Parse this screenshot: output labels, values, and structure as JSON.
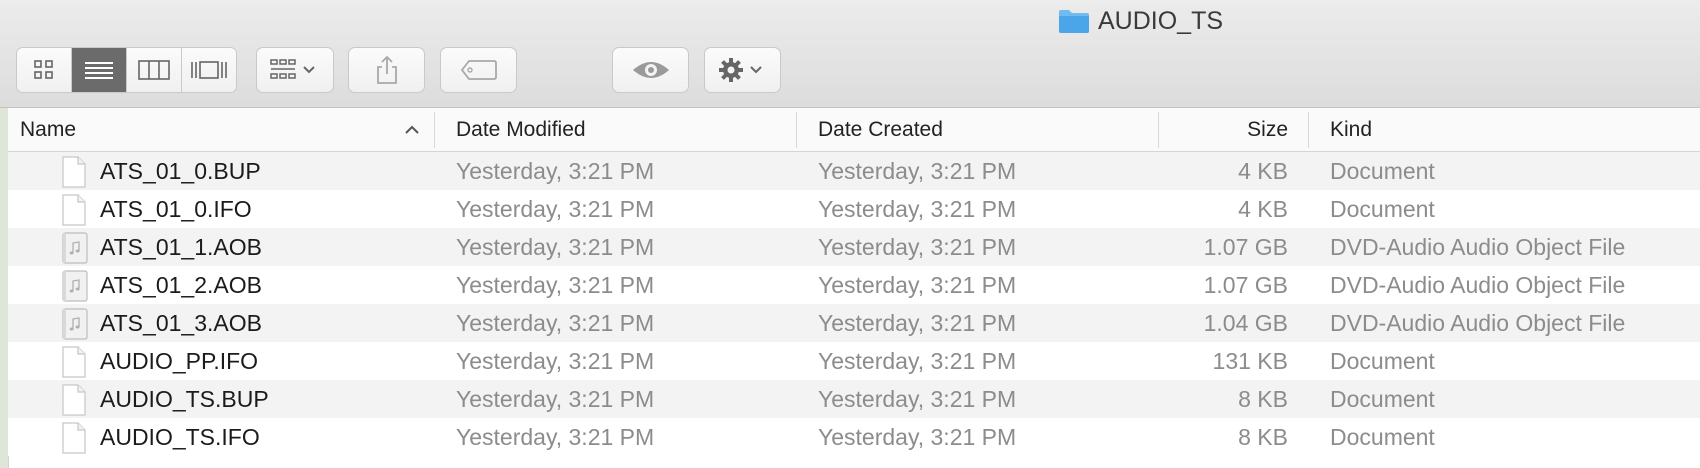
{
  "window": {
    "title": "AUDIO_TS",
    "title_icon": "folder-icon",
    "folder_color": "#4aa6e8"
  },
  "toolbar": {
    "view_buttons": [
      {
        "name": "icon-view-button",
        "icon": "grid-icon",
        "active": false
      },
      {
        "name": "list-view-button",
        "icon": "list-icon",
        "active": true
      },
      {
        "name": "column-view-button",
        "icon": "columns-icon",
        "active": false
      },
      {
        "name": "gallery-view-button",
        "icon": "gallery-icon",
        "active": false
      }
    ],
    "group_button": {
      "icon": "group-icon"
    },
    "share_button": {
      "icon": "share-icon"
    },
    "tag_button": {
      "icon": "tag-icon"
    },
    "quicklook_button": {
      "icon": "eye-icon"
    },
    "action_button": {
      "icon": "gear-icon"
    }
  },
  "columns": {
    "name": "Name",
    "date_modified": "Date Modified",
    "date_created": "Date Created",
    "size": "Size",
    "kind": "Kind",
    "sort_indicator": "ascending"
  },
  "files": [
    {
      "name": "ATS_01_0.BUP",
      "modified": "Yesterday, 3:21 PM",
      "created": "Yesterday, 3:21 PM",
      "size": "4 KB",
      "kind": "Document",
      "icon": "document-icon"
    },
    {
      "name": "ATS_01_0.IFO",
      "modified": "Yesterday, 3:21 PM",
      "created": "Yesterday, 3:21 PM",
      "size": "4 KB",
      "kind": "Document",
      "icon": "document-icon"
    },
    {
      "name": "ATS_01_1.AOB",
      "modified": "Yesterday, 3:21 PM",
      "created": "Yesterday, 3:21 PM",
      "size": "1.07 GB",
      "kind": "DVD-Audio Audio Object File",
      "icon": "audio-file-icon"
    },
    {
      "name": "ATS_01_2.AOB",
      "modified": "Yesterday, 3:21 PM",
      "created": "Yesterday, 3:21 PM",
      "size": "1.07 GB",
      "kind": "DVD-Audio Audio Object File",
      "icon": "audio-file-icon"
    },
    {
      "name": "ATS_01_3.AOB",
      "modified": "Yesterday, 3:21 PM",
      "created": "Yesterday, 3:21 PM",
      "size": "1.04 GB",
      "kind": "DVD-Audio Audio Object File",
      "icon": "audio-file-icon"
    },
    {
      "name": "AUDIO_PP.IFO",
      "modified": "Yesterday, 3:21 PM",
      "created": "Yesterday, 3:21 PM",
      "size": "131 KB",
      "kind": "Document",
      "icon": "document-icon"
    },
    {
      "name": "AUDIO_TS.BUP",
      "modified": "Yesterday, 3:21 PM",
      "created": "Yesterday, 3:21 PM",
      "size": "8 KB",
      "kind": "Document",
      "icon": "document-icon"
    },
    {
      "name": "AUDIO_TS.IFO",
      "modified": "Yesterday, 3:21 PM",
      "created": "Yesterday, 3:21 PM",
      "size": "8 KB",
      "kind": "Document",
      "icon": "document-icon"
    }
  ]
}
